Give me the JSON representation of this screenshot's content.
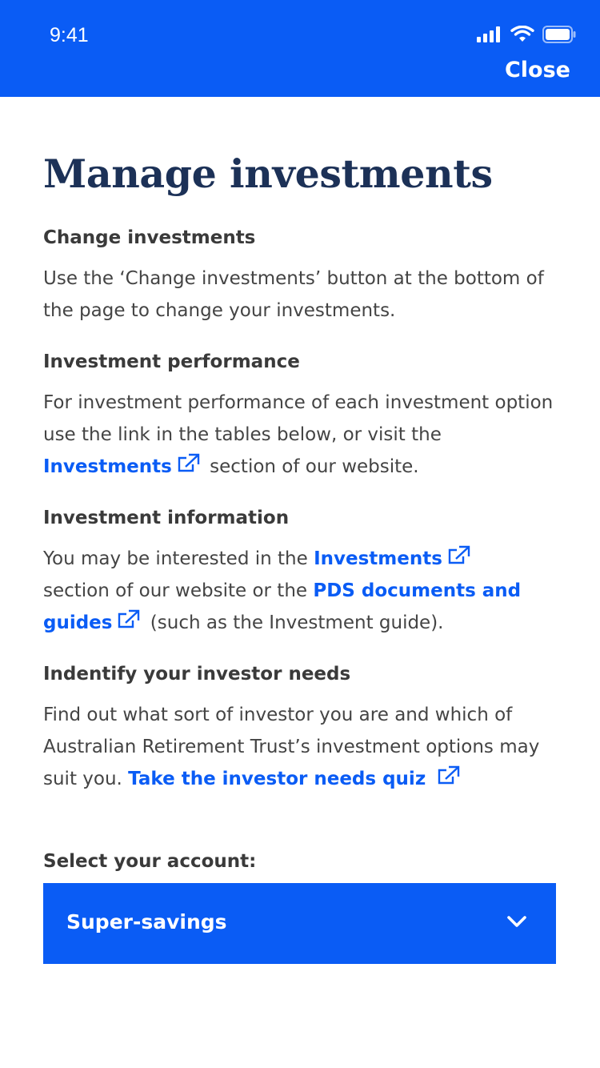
{
  "status_bar": {
    "time": "9:41"
  },
  "header": {
    "close_label": "Close"
  },
  "page": {
    "title": "Manage investments",
    "sections": [
      {
        "heading": "Change investments",
        "text": "Use the ‘Change investments’ button at the bottom of the page to change your investments."
      },
      {
        "heading": "Investment performance",
        "text_before": "For investment performance of each investment option use the link in the tables below, or visit the",
        "link": "Investments",
        "text_after": "section of our website."
      },
      {
        "heading": "Investment information",
        "text_before": "You may be interested in the",
        "link1": "Investments",
        "text_middle": "section of our website or the",
        "link2": "PDS documents and guides",
        "text_after": "(such as the Investment guide)."
      },
      {
        "heading": "Indentify your investor needs",
        "text_before": "Find out what sort of investor you are and which of Australian Retirement Trust’s investment options may suit you.",
        "link": "Take the investor needs quiz"
      }
    ]
  },
  "account": {
    "label": "Select your account:",
    "selected": "Super-savings"
  },
  "colors": {
    "brand_blue": "#0a5cf5",
    "title_navy": "#1c3157"
  },
  "icons": [
    "signal-icon",
    "wifi-icon",
    "battery-icon",
    "external-link-icon",
    "chevron-down-icon"
  ]
}
